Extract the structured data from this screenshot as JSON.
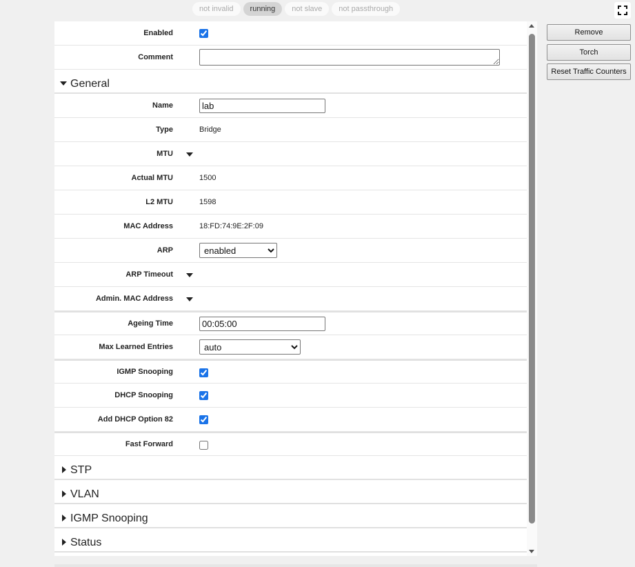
{
  "status_pills": [
    {
      "label": "not invalid",
      "active": false
    },
    {
      "label": "running",
      "active": true
    },
    {
      "label": "not slave",
      "active": false
    },
    {
      "label": "not passthrough",
      "active": false
    }
  ],
  "fullscreen_icon": "expand-icon",
  "form": {
    "enabled": {
      "label": "Enabled",
      "checked": true
    },
    "comment": {
      "label": "Comment",
      "value": ""
    },
    "general": {
      "title": "General",
      "name": {
        "label": "Name",
        "value": "lab"
      },
      "type": {
        "label": "Type",
        "value": "Bridge"
      },
      "mtu": {
        "label": "MTU"
      },
      "actual_mtu": {
        "label": "Actual MTU",
        "value": "1500"
      },
      "l2_mtu": {
        "label": "L2 MTU",
        "value": "1598"
      },
      "mac_address": {
        "label": "MAC Address",
        "value": "18:FD:74:9E:2F:09"
      },
      "arp": {
        "label": "ARP",
        "value": "enabled"
      },
      "arp_timeout": {
        "label": "ARP Timeout"
      },
      "admin_mac": {
        "label": "Admin. MAC Address"
      },
      "ageing_time": {
        "label": "Ageing Time",
        "value": "00:05:00"
      },
      "max_learned": {
        "label": "Max Learned Entries",
        "value": "auto"
      },
      "igmp_snooping": {
        "label": "IGMP Snooping",
        "checked": true
      },
      "dhcp_snooping": {
        "label": "DHCP Snooping",
        "checked": true
      },
      "dhcp_option82": {
        "label": "Add DHCP Option 82",
        "checked": true
      },
      "fast_forward": {
        "label": "Fast Forward",
        "checked": false
      }
    },
    "sections": {
      "stp": "STP",
      "vlan": "VLAN",
      "igmp": "IGMP Snooping",
      "status": "Status"
    }
  },
  "actions": {
    "remove": "Remove",
    "torch": "Torch",
    "reset": "Reset Traffic Counters"
  }
}
